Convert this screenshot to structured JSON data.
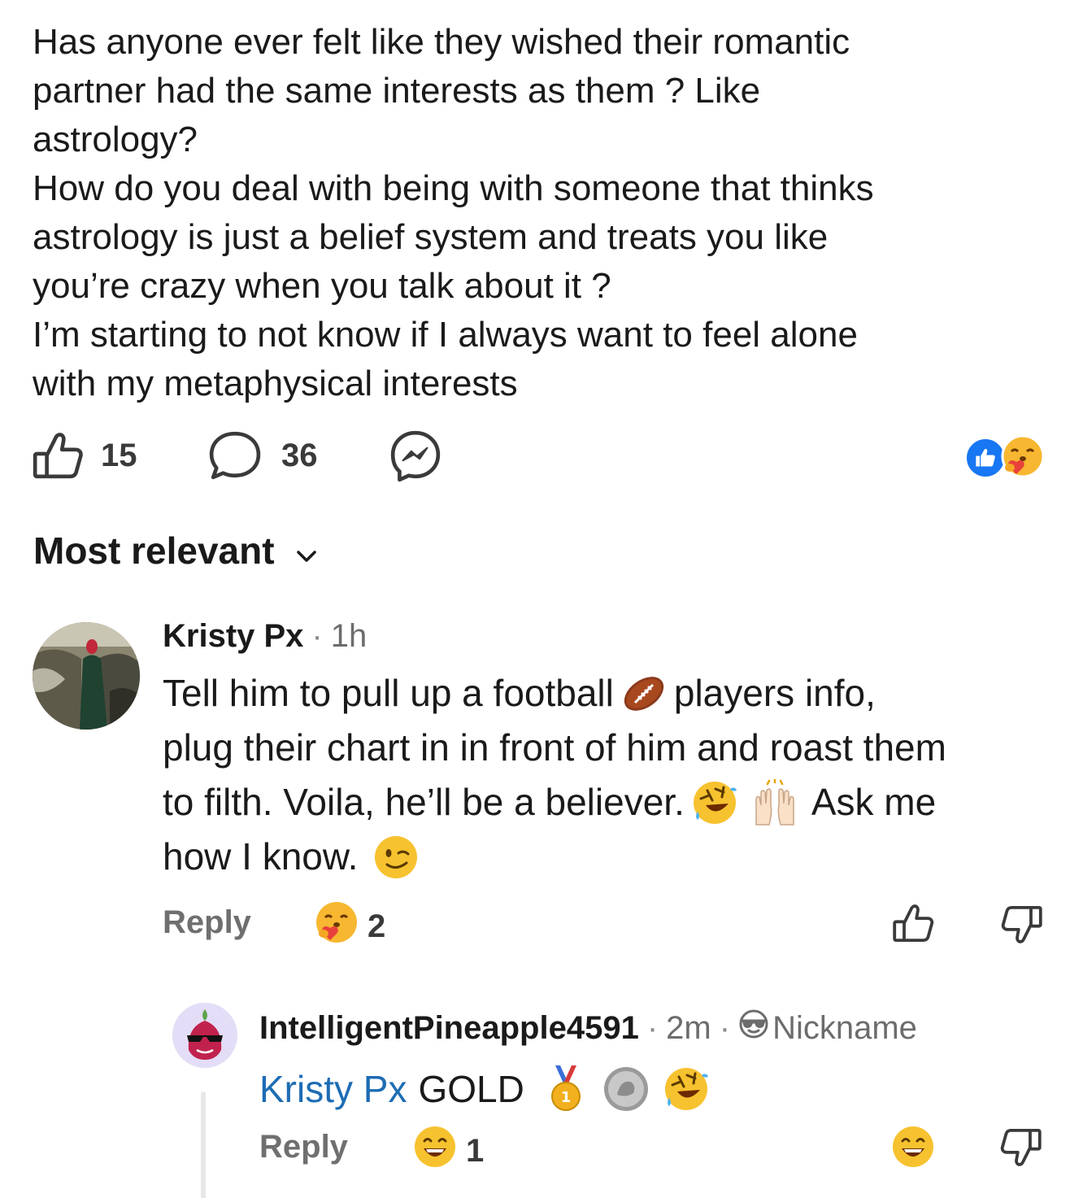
{
  "post": {
    "lines": [
      "Has anyone ever felt like they wished their romantic",
      "partner had the same interests as them ? Like",
      "astrology?",
      "How do you deal with being with someone that thinks",
      "astrology is just a belief system and treats you like",
      "you’re crazy when you talk about it ?",
      "I’m starting to not know if I always want to feel alone",
      "with my metaphysical interests"
    ],
    "upvote_count": "15",
    "comment_count": "36",
    "reaction_icons": [
      "like-icon",
      "care-icon"
    ],
    "colors": {
      "like_blue": "#1877f2",
      "mention_blue": "#1d6cb4"
    }
  },
  "sort": {
    "label": "Most relevant"
  },
  "comments": [
    {
      "author": "Kristy Px",
      "time": "1h",
      "text": {
        "line1_a": "Tell him to pull up a football",
        "line1_b": "players info,",
        "line2": "plug their chart in in front of him and roast them",
        "line3_a": "to filth. Voila, he’ll be a believer.",
        "line3_b": "Ask me",
        "line4": "how I know."
      },
      "emojis": [
        "football-emoji",
        "rofl-emoji",
        "raising-hands-emoji",
        "winking-emoji"
      ],
      "reply_label": "Reply",
      "reaction_count": "2",
      "reaction_icon": "care-icon"
    },
    {
      "author": "IntelligentPineapple4591",
      "time": "2m",
      "flair": "Nickname",
      "mention": "Kristy Px",
      "word": "GOLD",
      "emojis": [
        "gold-medal-emoji",
        "coin-emoji",
        "rofl-emoji"
      ],
      "reply_label": "Reply",
      "reaction_count": "1",
      "reaction_icon": "grinning-icon"
    }
  ]
}
